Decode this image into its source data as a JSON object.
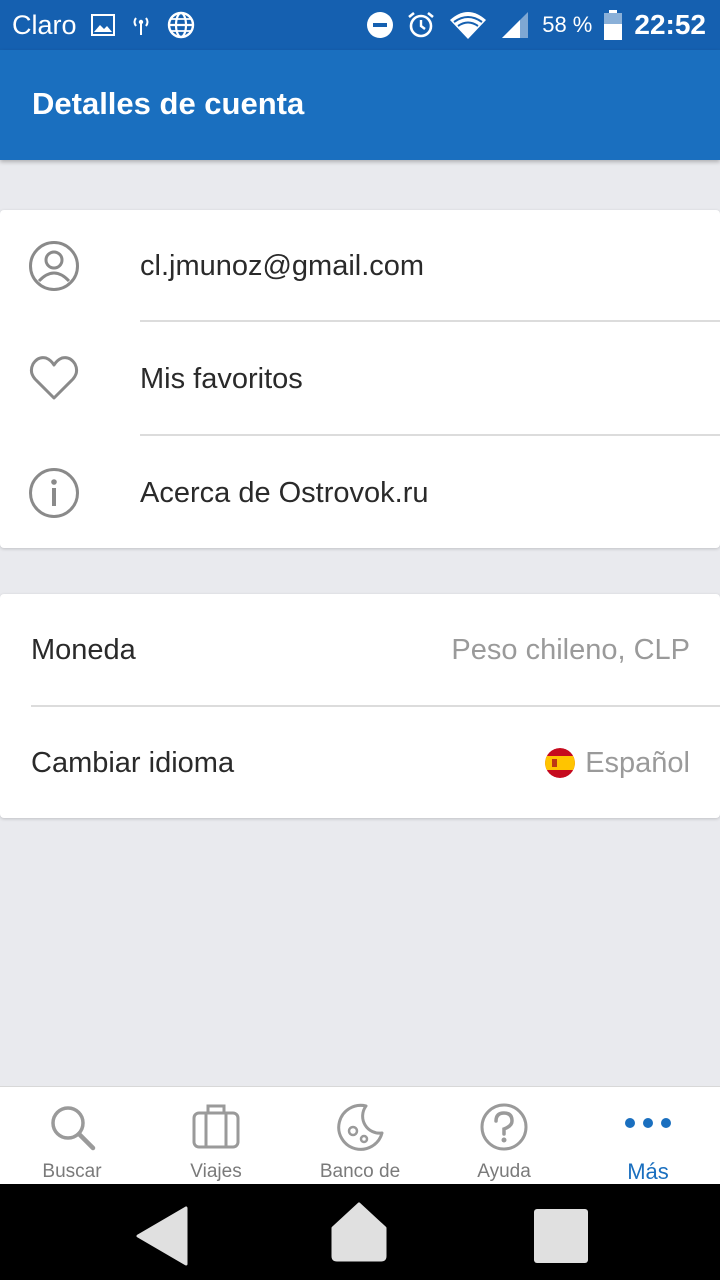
{
  "status_bar": {
    "carrier": "Claro",
    "battery": "58 %",
    "time": "22:52",
    "icons": [
      "image-icon",
      "signal-tower-icon",
      "globe-icon",
      "do-not-disturb-icon",
      "alarm-icon",
      "wifi-icon",
      "cell-signal-icon",
      "battery-icon"
    ]
  },
  "app_bar": {
    "title": "Detalles de cuenta"
  },
  "account_card": {
    "items": [
      {
        "label": "cl.jmunoz@gmail.com",
        "icon": "user-circle-icon"
      },
      {
        "label": "Mis favoritos",
        "icon": "heart-icon"
      },
      {
        "label": "Acerca de Ostrovok.ru",
        "icon": "info-icon"
      }
    ]
  },
  "settings_card": {
    "currency_label": "Moneda",
    "currency_value": "Peso chileno, CLP",
    "language_label": "Cambiar idioma",
    "language_value": "Español",
    "language_flag": "spain-flag-icon"
  },
  "bottom_nav": {
    "items": [
      {
        "label": "Buscar",
        "icon": "search-icon"
      },
      {
        "label": "Viajes",
        "icon": "suitcase-icon"
      },
      {
        "label": "Banco de",
        "icon": "moon-icon"
      },
      {
        "label": "Ayuda",
        "icon": "help-icon"
      },
      {
        "label": "Más",
        "icon": "more-dots-icon",
        "active": true
      }
    ]
  },
  "colors": {
    "primary": "#1a6fbf",
    "status_bar": "#1560b0",
    "background": "#e9eaee"
  }
}
